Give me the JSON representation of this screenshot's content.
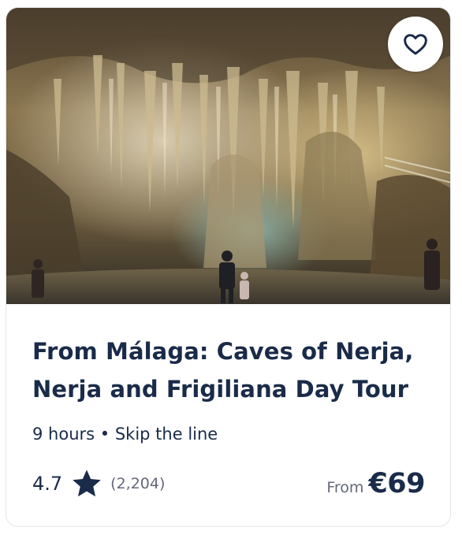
{
  "card": {
    "image_alt": "Caves of Nerja interior",
    "title": "From Málaga: Caves of Nerja, Nerja and Frigiliana Day Tour",
    "duration": "9 hours",
    "separator": "•",
    "feature": "Skip the line",
    "rating": "4.7",
    "reviews": "(2,204)",
    "price_prefix": "From",
    "price": "€69",
    "favorite_icon": "heart-outline-icon",
    "rating_icon": "star-icon"
  },
  "colors": {
    "text": "#1a2b49",
    "muted": "#63687a",
    "border": "#e2e4ea"
  }
}
